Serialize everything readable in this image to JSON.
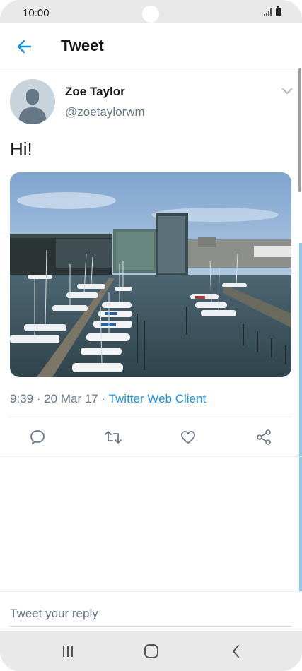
{
  "status_bar": {
    "time": "10:00"
  },
  "header": {
    "title": "Tweet"
  },
  "tweet": {
    "display_name": "Zoe Taylor",
    "handle": "@zoetaylorwm",
    "text": "Hi!",
    "time": "9:39",
    "separator": " · ",
    "date": "20 Mar 17",
    "client": "Twitter Web Client"
  },
  "reply": {
    "placeholder": "Tweet your reply"
  },
  "icons": {
    "back": "arrow-left-icon",
    "caret": "chevron-down-icon",
    "reply": "comment-icon",
    "retweet": "retweet-icon",
    "like": "heart-icon",
    "share": "share-icon"
  },
  "colors": {
    "accent": "#1b95e0",
    "text": "#14171a",
    "secondary": "#657786"
  }
}
